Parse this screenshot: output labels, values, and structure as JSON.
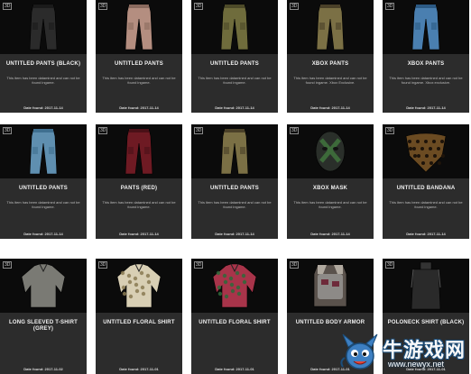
{
  "badge": "3D",
  "rows": [
    [
      {
        "name": "UNTITLED PANTS (BLACK)",
        "desc": "This item has been datamined and can not be found ingame.",
        "date": "Date found: 2017-11-14",
        "icon": "black-cargo-pants-icon"
      },
      {
        "name": "UNTITLED PANTS",
        "desc": "This item has been datamined and can not be found ingame.",
        "date": "Date found: 2017-11-14",
        "icon": "pink-pants-icon"
      },
      {
        "name": "UNTITLED PANTS",
        "desc": "This item has been datamined and can not be found ingame.",
        "date": "Date found: 2017-11-14",
        "icon": "olive-pants-icon"
      },
      {
        "name": "XBOX PANTS",
        "desc": "This item has been datamined and can not be found ingame. Xbox Exclusive.",
        "date": "Date found: 2017-11-14",
        "icon": "camo-pants-icon"
      },
      {
        "name": "XBOX PANTS",
        "desc": "This item has been datamined and can not be found ingame. Xbox exclusive.",
        "date": "Date found: 2017-11-14",
        "icon": "blue-jeans-icon"
      }
    ],
    [
      {
        "name": "UNTITLED PANTS",
        "desc": "This item has been datamined and can not be found ingame.",
        "date": "Date found: 2017-11-14",
        "icon": "light-jeans-icon"
      },
      {
        "name": "PANTS (RED)",
        "desc": "This item has been datamined and can not be found ingame.",
        "date": "Date found: 2017-11-14",
        "icon": "red-pants-icon"
      },
      {
        "name": "UNTITLED PANTS",
        "desc": "This item has been datamined and can not be found ingame.",
        "date": "Date found: 2017-11-14",
        "icon": "camo-pants-icon"
      },
      {
        "name": "XBOX MASK",
        "desc": "This item has been datamined and can not be found ingame.",
        "date": "Date found: 2017-11-14",
        "icon": "mask-icon"
      },
      {
        "name": "UNTITLED BANDANA",
        "desc": "This item has been datamined and can not be found ingame.",
        "date": "Date found: 2017-11-14",
        "icon": "bandana-icon"
      }
    ],
    [
      {
        "name": "LONG SLEEVED T-SHIRT (GREY)",
        "desc": "",
        "date": "Date found: 2017-11-02",
        "icon": "grey-shirt-icon"
      },
      {
        "name": "UNTITLED FLORAL SHIRT",
        "desc": "",
        "date": "Date found: 2017-11-01",
        "icon": "floral-shirt-icon"
      },
      {
        "name": "UNTITLED FLORAL SHIRT",
        "desc": "",
        "date": "Date found: 2017-11-01",
        "icon": "red-floral-shirt-icon"
      },
      {
        "name": "UNTITLED BODY ARMOR",
        "desc": "",
        "date": "Date found: 2017-11-01",
        "icon": "body-armor-icon"
      },
      {
        "name": "POLONECK SHIRT (BLACK)",
        "desc": "",
        "date": "Date found: 2017-11-01",
        "icon": "poloneck-shirt-icon"
      }
    ]
  ],
  "watermark": {
    "site": "牛游戏网",
    "url": "www.newyx.net"
  },
  "colors": {
    "card_bg": "#2c2c2c",
    "image_bg": "#0b0b0b",
    "text": "#f1f1f1",
    "pants_black": "#2b2b2b",
    "pants_pink": "#b48e80",
    "pants_olive": "#6f6c3c",
    "pants_camo": "#7b7045",
    "pants_blue": "#4a7fb0",
    "pants_lightblue": "#5f8fb0",
    "pants_red": "#6e1a23",
    "pants_camo2": "#6e6650",
    "mask_green": "#3d6a3a",
    "bandana": "#6b4b22",
    "shirt_grey": "#7a7a74",
    "shirt_floral": "#d8cfb4",
    "shirt_red": "#a8344a",
    "armor": "#8d8a87",
    "poloneck": "#2a2a2a"
  }
}
